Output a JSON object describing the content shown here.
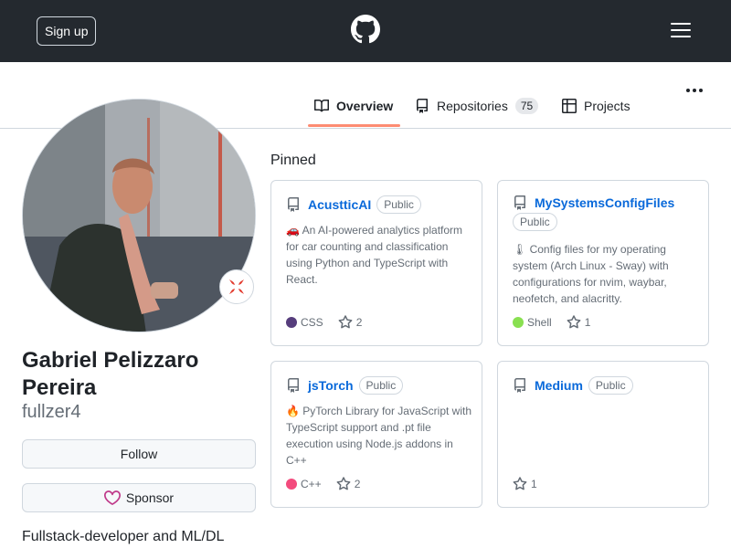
{
  "header": {
    "signup_label": "Sign up",
    "logo_icon": "github-mark-icon",
    "menu_icon": "hamburger-icon"
  },
  "tabs": [
    {
      "label": "Overview",
      "icon": "book-icon",
      "active": true
    },
    {
      "label": "Repositories",
      "icon": "repo-icon",
      "count": "75"
    },
    {
      "label": "Projects",
      "icon": "table-icon"
    }
  ],
  "profile": {
    "full_name": "Gabriel Pelizzaro Pereira",
    "username": "fullzer4",
    "status_emoji_icon": "anger-symbol-icon",
    "follow_label": "Follow",
    "sponsor_label": "Sponsor",
    "bio": "Fullstack-developer and ML/DL"
  },
  "pinned": {
    "title": "Pinned",
    "repos": [
      {
        "name": "AcustticAI",
        "visibility": "Public",
        "description": "🚗 An AI-powered analytics platform for car counting and classification using Python and TypeScript with React.",
        "language": "CSS",
        "language_color": "#563d7c",
        "stars": "2"
      },
      {
        "name": "MySystemsConfigFiles",
        "visibility": "Public",
        "description": "🌡 Config files for my operating system (Arch Linux - Sway) with configurations for nvim, waybar, neofetch, and alacritty.",
        "language": "Shell",
        "language_color": "#89e051",
        "stars": "1"
      },
      {
        "name": "jsTorch",
        "visibility": "Public",
        "description": "🔥 PyTorch Library for JavaScript with TypeScript support and .pt file execution using Node.js addons in C++",
        "language": "C++",
        "language_color": "#f34b7d",
        "stars": "2"
      },
      {
        "name": "Medium",
        "visibility": "Public",
        "description": "",
        "language": "",
        "language_color": "",
        "stars": "1"
      }
    ]
  },
  "colors": {
    "header_bg": "#24292f",
    "link": "#0969da",
    "tab_underline": "#fd8c73",
    "sponsor_heart": "#bf3989"
  }
}
